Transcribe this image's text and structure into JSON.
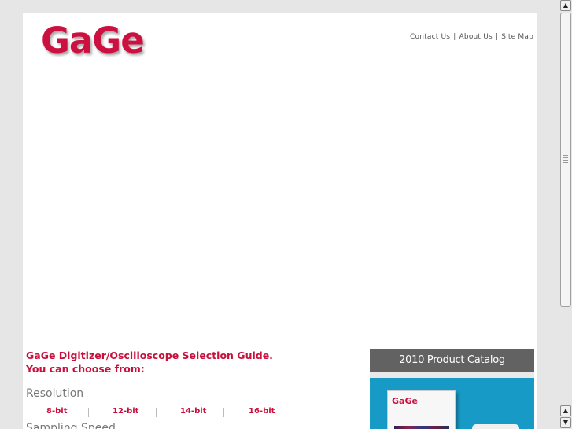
{
  "header": {
    "logo_text": "GaGe",
    "links": [
      {
        "label": "Contact Us"
      },
      {
        "label": "About Us"
      },
      {
        "label": "Site Map"
      }
    ],
    "separator": "|"
  },
  "guide": {
    "title_line1": "GaGe Digitizer/Oscilloscope Selection Guide.",
    "title_line2": "You can choose from:"
  },
  "resolution": {
    "heading": "Resolution",
    "options": [
      "8-bit",
      "12-bit",
      "14-bit",
      "16-bit"
    ]
  },
  "sampling": {
    "heading": "Sampling Speed"
  },
  "catalog": {
    "title": "2010 Product Catalog",
    "cover_logo": "GaGe"
  },
  "colors": {
    "brand": "#cc1040",
    "link_text": "#555555",
    "catalog_bar": "#626262",
    "catalog_body": "#179ac6"
  },
  "scrollbar": {
    "up_icon": "arrow-up-icon",
    "down_icon": "arrow-down-icon"
  }
}
